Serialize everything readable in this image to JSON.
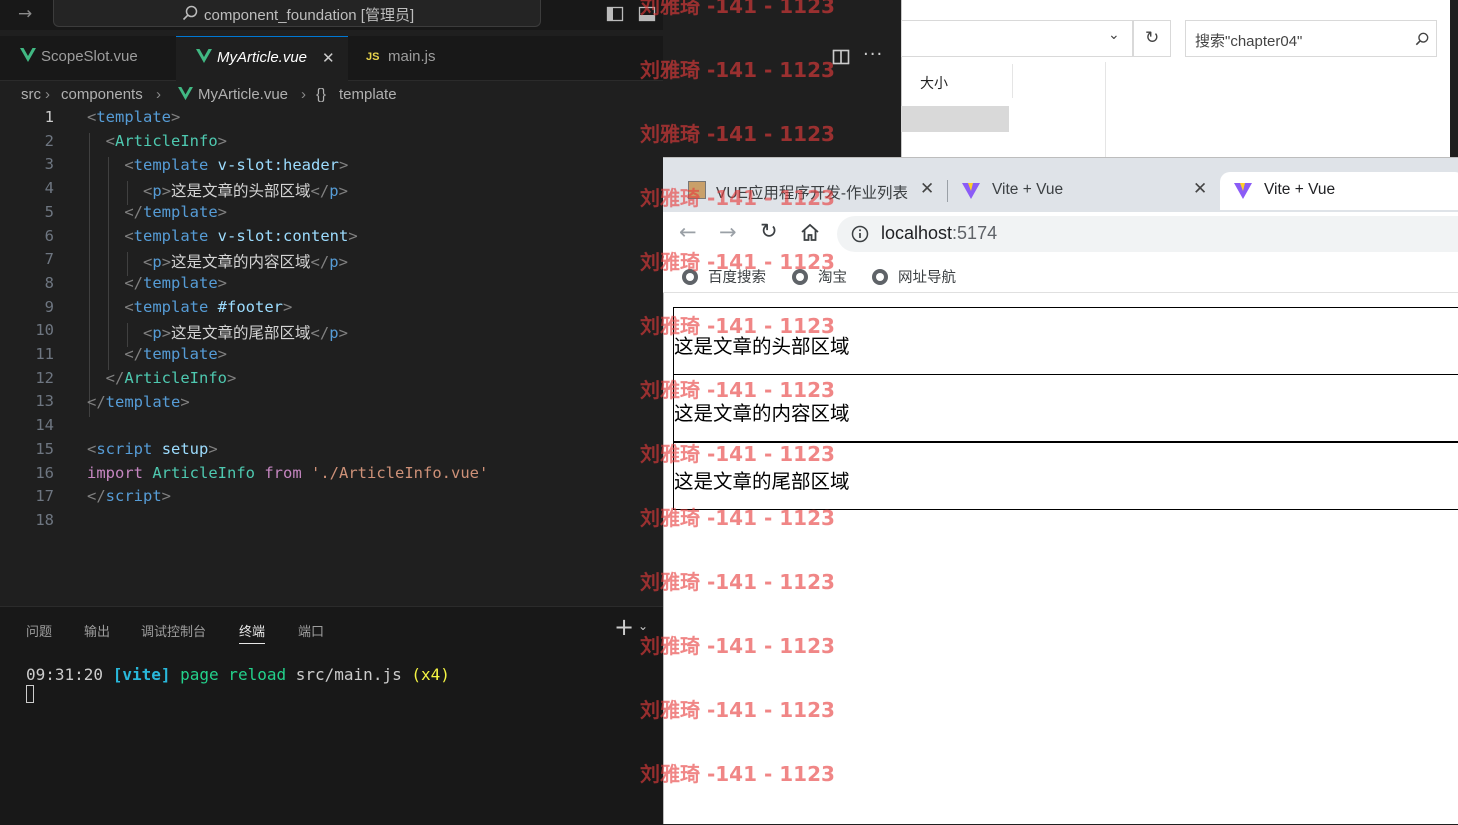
{
  "vscode": {
    "command_center": "component_foundation [管理员]",
    "tabs": [
      {
        "label": "ScopeSlot.vue",
        "kind": "vue"
      },
      {
        "label": "MyArticle.vue",
        "kind": "vue",
        "active": true
      },
      {
        "label": "main.js",
        "kind": "js"
      }
    ],
    "js_badge": "JS",
    "breadcrumb": {
      "a": "src",
      "b": "components",
      "c": "MyArticle.vue",
      "d_icon": "{}",
      "d": "template"
    },
    "line_numbers": [
      "1",
      "2",
      "3",
      "4",
      "5",
      "6",
      "7",
      "8",
      "9",
      "10",
      "11",
      "12",
      "13",
      "14",
      "15",
      "16",
      "17",
      "18"
    ],
    "panel_tabs": [
      "问题",
      "输出",
      "调试控制台",
      "终端",
      "端口"
    ],
    "terminal": {
      "time": "09:31:20",
      "tag": "[vite]",
      "msg": "page reload",
      "file": "src/main.js",
      "count": "(x4)"
    }
  },
  "explorer": {
    "search_placeholder": "搜索\"chapter04\"",
    "column": "大小"
  },
  "browser": {
    "tabs": [
      {
        "label": "VUE应用程序开发-作业列表"
      },
      {
        "label": "Vite + Vue"
      },
      {
        "label": "Vite + Vue",
        "active": true
      }
    ],
    "url_host": "localhost",
    "url_port": ":5174",
    "bookmarks": [
      "百度搜索",
      "淘宝",
      "网址导航"
    ],
    "sections": [
      "这是文章的头部区域",
      "这是文章的内容区域",
      "这是文章的尾部区域"
    ]
  },
  "watermark": "刘雅琦 -141 - 1123",
  "colors": {
    "accent": "#0078d4",
    "vue_green": "#41b883",
    "watermark": "#e63c3c"
  }
}
